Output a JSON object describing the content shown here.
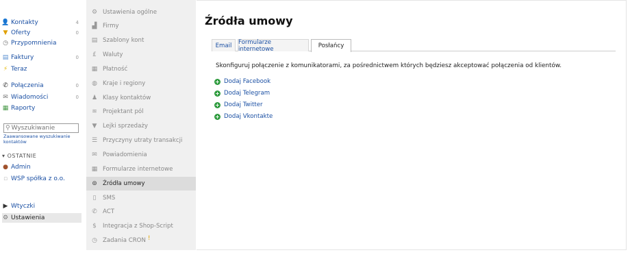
{
  "sidebar": {
    "items": [
      {
        "label": "Kontakty",
        "count": "4",
        "icon": "user-icon",
        "glyph": "👤"
      },
      {
        "label": "Oferty",
        "count": "0",
        "icon": "funnel-icon",
        "glyph": "▼"
      },
      {
        "label": "Przypomnienia",
        "count": "",
        "icon": "clock-icon",
        "glyph": "◷"
      },
      {
        "label": "Faktury",
        "count": "0",
        "icon": "invoice-icon",
        "glyph": "▤"
      },
      {
        "label": "Teraz",
        "count": "",
        "icon": "lightning-icon",
        "glyph": "⚡"
      },
      {
        "label": "Połączenia",
        "count": "0",
        "icon": "phone-icon",
        "glyph": "✆"
      },
      {
        "label": "Wiadomości",
        "count": "0",
        "icon": "envelope-icon",
        "glyph": "✉"
      },
      {
        "label": "Raporty",
        "count": "",
        "icon": "chart-icon",
        "glyph": "▦"
      }
    ],
    "search": {
      "placeholder": "Wyszukiwanie"
    },
    "advanced_search": "Zaawansowane wyszukiwanie kontaktów",
    "recent_header": "OSTATNIE",
    "recent": [
      {
        "label": "Admin",
        "icon": "avatar-icon",
        "glyph": "●"
      },
      {
        "label": "WSP spółka z o.o.",
        "icon": "company-icon",
        "glyph": "▫"
      }
    ],
    "bottom": [
      {
        "label": "Wtyczki",
        "icon": "plugin-icon",
        "glyph": "▶"
      },
      {
        "label": "Ustawienia",
        "icon": "gear-icon",
        "glyph": "⚙"
      }
    ]
  },
  "settings_menu": {
    "items": [
      {
        "label": "Ustawienia ogólne",
        "icon": "gear-icon",
        "glyph": "⚙"
      },
      {
        "label": "Firmy",
        "icon": "building-icon",
        "glyph": "▟"
      },
      {
        "label": "Szablony kont",
        "icon": "document-icon",
        "glyph": "▤"
      },
      {
        "label": "Waluty",
        "icon": "currency-icon",
        "glyph": "£"
      },
      {
        "label": "Płatność",
        "icon": "payment-icon",
        "glyph": "▦"
      },
      {
        "label": "Kraje i regiony",
        "icon": "globe-icon",
        "glyph": "◍"
      },
      {
        "label": "Klasy kontaktów",
        "icon": "users-icon",
        "glyph": "♟"
      },
      {
        "label": "Projektant pól",
        "icon": "fields-icon",
        "glyph": "≋"
      },
      {
        "label": "Lejki sprzedaży",
        "icon": "funnel-icon",
        "glyph": "▼"
      },
      {
        "label": "Przyczyny utraty transakcji",
        "icon": "list-icon",
        "glyph": "☰"
      },
      {
        "label": "Powiadomienia",
        "icon": "envelope-icon",
        "glyph": "✉"
      },
      {
        "label": "Formularze internetowe",
        "icon": "form-icon",
        "glyph": "▦"
      },
      {
        "label": "Źródła umowy",
        "icon": "source-icon",
        "glyph": "⊚"
      },
      {
        "label": "SMS",
        "icon": "mobile-icon",
        "glyph": "▯"
      },
      {
        "label": "ACT",
        "icon": "phone-icon",
        "glyph": "✆"
      },
      {
        "label": "Integracja z Shop-Script",
        "icon": "dollar-icon",
        "glyph": "$"
      },
      {
        "label": "Zadania CRON",
        "icon": "cron-icon",
        "glyph": "◷",
        "badge": "!"
      }
    ],
    "active_index": 12
  },
  "main": {
    "title": "Źródła umowy",
    "tabs": [
      {
        "label": "Email"
      },
      {
        "label": "Formularze internetowe"
      },
      {
        "label": "Posłańcy"
      }
    ],
    "active_tab": 2,
    "description": "Skonfiguruj połączenie z komunikatorami, za pośrednictwem których będziesz akceptować połączenia od klientów.",
    "add_links": [
      {
        "label": "Dodaj Facebook"
      },
      {
        "label": "Dodaj Telegram"
      },
      {
        "label": "Dodaj Twitter"
      },
      {
        "label": "Dodaj Vkontakte"
      }
    ]
  },
  "colors": {
    "link": "#1a4fa3",
    "add_icon": "#2e9b3e",
    "menu_bg": "#f0f0f0",
    "active_menu_bg": "#dcdcdc"
  }
}
